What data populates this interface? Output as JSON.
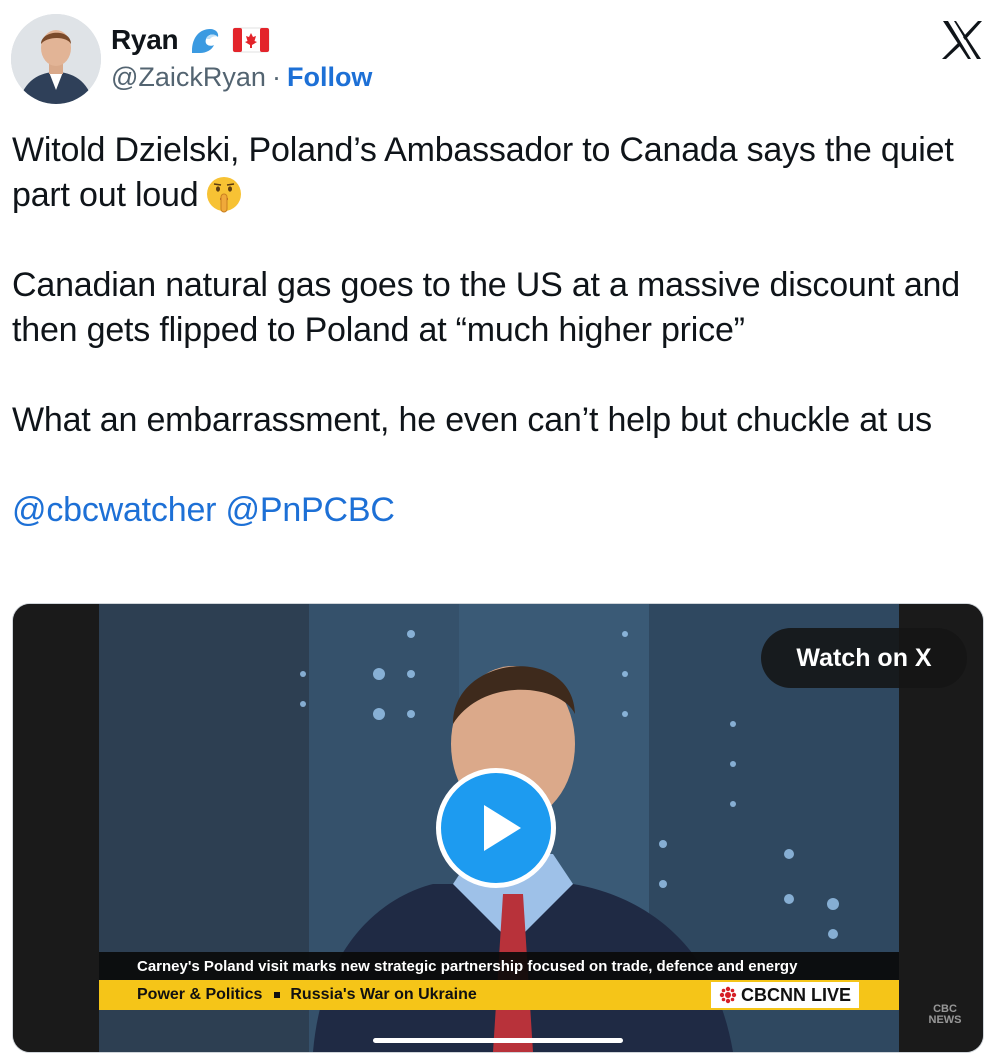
{
  "author": {
    "display_name": "Ryan",
    "handle": "@ZaickRyan",
    "separator": "·",
    "follow_label": "Follow",
    "badges": [
      "wave-emoji",
      "canada-flag-emoji"
    ]
  },
  "tweet": {
    "paragraph1": "Witold Dzielski, Poland’s Ambassador to Canada says the quiet part out loud",
    "paragraph1_emoji": "shushing-face-emoji",
    "paragraph2": "Canadian natural gas goes to the US at a massive discount and then gets flipped to Poland at “much higher price”",
    "paragraph3": "What an embarrassment, he even can’t help but chuckle at us",
    "mention1": "@cbcwatcher",
    "mention2": "@PnPCBC"
  },
  "media": {
    "watch_label": "Watch on X",
    "caption": "Carney's Poland visit marks new strategic partnership focused on trade, defence and energy",
    "ticker_show": "Power & Politics",
    "ticker_topic": "Russia's War on Ukraine",
    "live_badge": "CBCNN LIVE",
    "corner_logo_top": "CBC",
    "corner_logo_bottom": "NEWS"
  },
  "colors": {
    "link": "#1d70d6",
    "play_button": "#1d9bf0",
    "ticker": "#f5c518"
  }
}
